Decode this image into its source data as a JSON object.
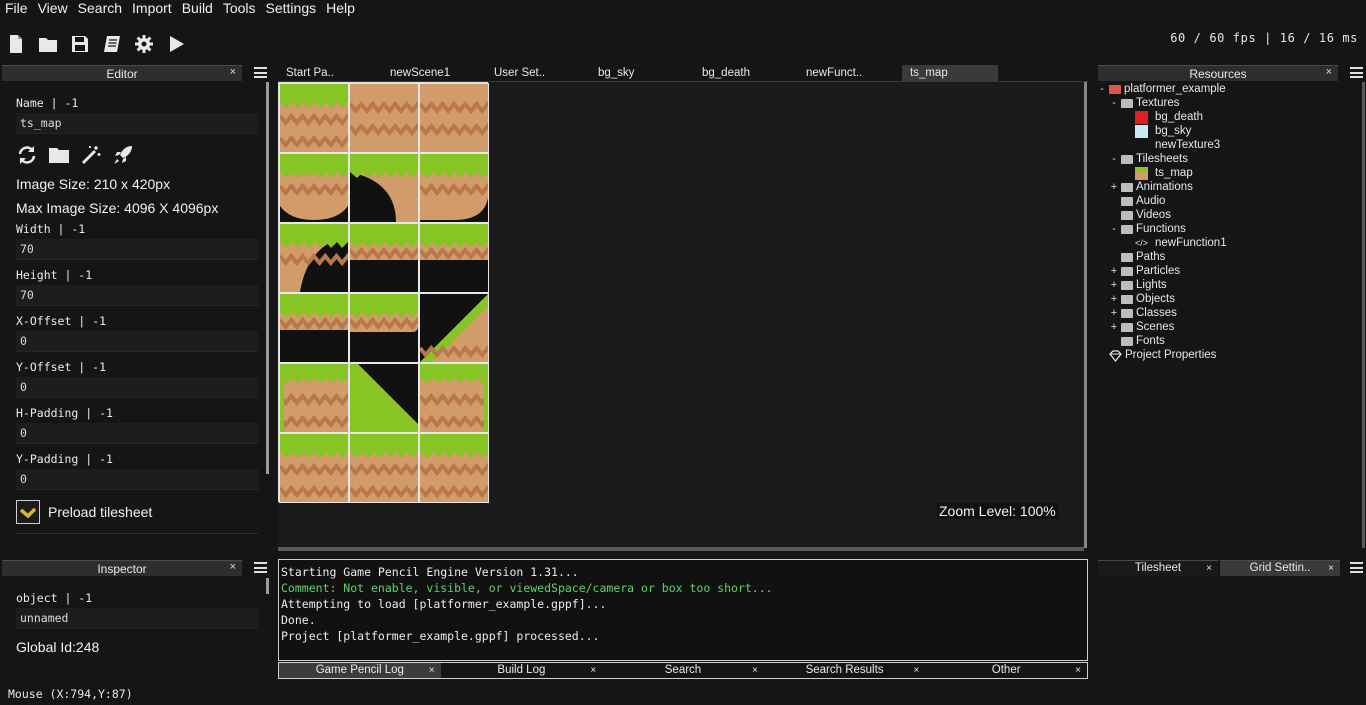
{
  "menu": [
    "File",
    "View",
    "Search",
    "Import",
    "Build",
    "Tools",
    "Settings",
    "Help"
  ],
  "toolbar": {
    "icons": [
      "new-file-icon",
      "open-folder-icon",
      "save-icon",
      "docs-icon",
      "settings-gear-icon",
      "play-icon"
    ]
  },
  "fps": "60 / 60 fps | 16 / 16 ms",
  "editor": {
    "title": "Editor",
    "close": "×",
    "name_label": "Name | -1",
    "name_value": "ts_map",
    "image_size": "Image Size: 210 x 420px",
    "max_image_size": "Max Image Size: 4096 X 4096px",
    "fields": [
      {
        "label": "Width | -1",
        "value": "70"
      },
      {
        "label": "Height | -1",
        "value": "70"
      },
      {
        "label": "X-Offset | -1",
        "value": "0"
      },
      {
        "label": "Y-Offset | -1",
        "value": "0"
      },
      {
        "label": "H-Padding | -1",
        "value": "0"
      },
      {
        "label": "Y-Padding | -1",
        "value": "0"
      }
    ],
    "preload_label": "Preload tilesheet",
    "preload_checked": true
  },
  "inspector": {
    "title": "Inspector",
    "close": "×",
    "object_label": "object | -1",
    "object_value": "unnamed",
    "global_id": "Global Id:248"
  },
  "scene_tabs": [
    {
      "label": "Start Pa..",
      "active": false
    },
    {
      "label": "newScene1",
      "active": false
    },
    {
      "label": "User Set..",
      "active": false
    },
    {
      "label": "bg_sky",
      "active": false
    },
    {
      "label": "bg_death",
      "active": false
    },
    {
      "label": "newFunct..",
      "active": false
    },
    {
      "label": "ts_map",
      "active": true
    }
  ],
  "tilesheet": {
    "columns": 3,
    "rows": 6,
    "tiles": [
      "top",
      "fill",
      "fill",
      "round-bottom",
      "curve-left",
      "round-bottom-r",
      "curve-down",
      "ledge",
      "ledge",
      "ledge",
      "ledge-r",
      "slope-up",
      "side-left",
      "slope-down",
      "side-right",
      "top",
      "top",
      "top"
    ]
  },
  "zoom": "Zoom Level: 100%",
  "log": {
    "lines": [
      {
        "text": "Starting Game Pencil Engine Version 1.31...",
        "type": "normal"
      },
      {
        "text": "Comment: Not enable, visible, or viewedSpace/camera or box too short...",
        "type": "comment"
      },
      {
        "text": "Attempting to load [platformer_example.gppf]...",
        "type": "normal"
      },
      {
        "text": "Done.",
        "type": "normal"
      },
      {
        "text": "Project [platformer_example.gppf] processed...",
        "type": "normal"
      }
    ],
    "tabs": [
      {
        "label": "Game Pencil Log",
        "active": true
      },
      {
        "label": "Build Log",
        "active": false
      },
      {
        "label": "Search",
        "active": false
      },
      {
        "label": "Search Results",
        "active": false
      },
      {
        "label": "Other",
        "active": false
      }
    ],
    "close": "×"
  },
  "resources": {
    "title": "Resources",
    "close": "×",
    "tree": [
      {
        "label": "platformer_example",
        "toggle": "-",
        "kind": "red-folder",
        "depth": 0
      },
      {
        "label": "Textures",
        "toggle": "-",
        "kind": "folder",
        "depth": 1
      },
      {
        "label": "bg_death",
        "toggle": "",
        "kind": "texture-red",
        "depth": 2
      },
      {
        "label": "bg_sky",
        "toggle": "",
        "kind": "texture-sky",
        "depth": 2
      },
      {
        "label": "newTexture3",
        "toggle": "",
        "kind": "texture-empty",
        "depth": 2
      },
      {
        "label": "Tilesheets",
        "toggle": "-",
        "kind": "folder",
        "depth": 1
      },
      {
        "label": "ts_map",
        "toggle": "",
        "kind": "tilesheet",
        "depth": 2
      },
      {
        "label": "Animations",
        "toggle": "+",
        "kind": "folder",
        "depth": 1
      },
      {
        "label": "Audio",
        "toggle": "",
        "kind": "folder",
        "depth": 1
      },
      {
        "label": "Videos",
        "toggle": "",
        "kind": "folder",
        "depth": 1
      },
      {
        "label": "Functions",
        "toggle": "-",
        "kind": "folder",
        "depth": 1
      },
      {
        "label": "newFunction1",
        "toggle": "",
        "kind": "code",
        "depth": 2
      },
      {
        "label": "Paths",
        "toggle": "",
        "kind": "folder",
        "depth": 1
      },
      {
        "label": "Particles",
        "toggle": "+",
        "kind": "folder",
        "depth": 1
      },
      {
        "label": "Lights",
        "toggle": "+",
        "kind": "folder",
        "depth": 1
      },
      {
        "label": "Objects",
        "toggle": "+",
        "kind": "folder",
        "depth": 1
      },
      {
        "label": "Classes",
        "toggle": "+",
        "kind": "folder",
        "depth": 1
      },
      {
        "label": "Scenes",
        "toggle": "+",
        "kind": "folder",
        "depth": 1
      },
      {
        "label": "Fonts",
        "toggle": "",
        "kind": "folder",
        "depth": 1
      },
      {
        "label": "Project Properties",
        "toggle": "",
        "kind": "gem",
        "depth": 0
      }
    ]
  },
  "bottom_right_tabs": [
    {
      "label": "Tilesheet",
      "active": false
    },
    {
      "label": "Grid Settin..",
      "active": true
    }
  ],
  "status": "Mouse (X:794,Y:87)",
  "colors": {
    "grass": "#86c523",
    "grass_dark": "#5a8d1e",
    "dirt": "#d29b6a",
    "dirt_zigzag": "#b9784a",
    "comment": "#5ed36a"
  }
}
